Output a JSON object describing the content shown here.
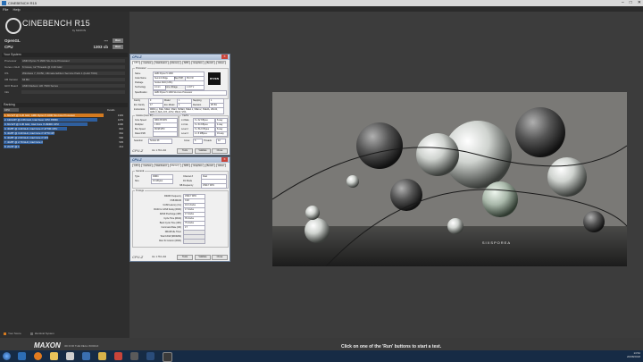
{
  "window": {
    "title": "CINEBENCH R15"
  },
  "menu": [
    "File",
    "Help"
  ],
  "app": {
    "name": "CINEBENCH R15",
    "by": "by MAXON"
  },
  "benchmarks": [
    {
      "label": "OpenGL",
      "value": "---",
      "run": "Run"
    },
    {
      "label": "CPU",
      "value": "1303 cb",
      "run": "Run"
    }
  ],
  "system": {
    "header": "Your System",
    "rows": [
      {
        "k": "Processor",
        "v": "AMD Ryzen 5 1600 Six-Core Processor"
      },
      {
        "k": "Cores x GHz",
        "v": "6 Cores, 12 Threads @ 3.20 GHz"
      },
      {
        "k": "OS",
        "v": "Windows 7, 64 Bit, Ultimate Edition Service Pack 1 (build 7601)"
      },
      {
        "k": "CB Version",
        "v": "64 Bit"
      },
      {
        "k": "GFX Board",
        "v": "AMD Radeon HD 7900 Series"
      },
      {
        "k": "Info",
        "v": ""
      }
    ]
  },
  "ranking": {
    "header": "Ranking",
    "dropdown": "CPU",
    "details": "Details",
    "items": [
      {
        "label": "1. 6C/12T @ 3.20 GHz, AMD Ryzen 5 1600 Six-Core Processor",
        "score": "1303",
        "color": "#d47a1f",
        "frac": 1.0
      },
      {
        "label": "2. 12C/24T @ 2.66 GHz, Intel Xeon CPU X5650",
        "score": "1279",
        "color": "#2f5f9e",
        "frac": 0.94
      },
      {
        "label": "3. 6C/12T @ 3.30 GHz, Intel Core i7-3930K CPU",
        "score": "1096",
        "color": "#2f5f9e",
        "frac": 0.84
      },
      {
        "label": "4. 4C/8T @ 4.40 GHz, Intel Core i7-4770K CPU",
        "score": "822",
        "color": "#2f5f9e",
        "frac": 0.63
      },
      {
        "label": "5. 4C/8T @ 3.40 GHz, Intel Core i7-3770 CPU",
        "score": "662",
        "color": "#2f5f9e",
        "frac": 0.51
      },
      {
        "label": "6. 4C/8T @ 2.60 GHz, Intel Core i7-3720QM CPU",
        "score": "590",
        "color": "#2f5f9e",
        "frac": 0.45
      },
      {
        "label": "7. 4C/8T @ 2.79 GHz, Intel Core i7-3840QM CPU",
        "score": "505",
        "color": "#2f5f9e",
        "frac": 0.39
      },
      {
        "label": "8. 2C/4T @ 1.70 GHz, Intel Core i5-3317U CPU",
        "score": "214",
        "color": "#2f5f9e",
        "frac": 0.16
      }
    ]
  },
  "legend": {
    "your_score": "Your Score",
    "identical": "Identical System",
    "your_color": "#d47a1f",
    "identical_color": "#6a6a6a"
  },
  "footer": {
    "brand": "MAXON",
    "tagline": "3D FOR THE REAL WORLD"
  },
  "status": "Click on one of the 'Run' buttons to start a test.",
  "render_watermark": "SIXSPOREA",
  "cpuz1": {
    "brand": "CPU-Z",
    "tabs": [
      "CPU",
      "Caches",
      "Mainboard",
      "Memory",
      "SPD",
      "Graphics",
      "Bench",
      "About"
    ],
    "processor": {
      "title": "Processor",
      "name_k": "Name",
      "name_v": "AMD Ryzen 5 1600",
      "codename_k": "Code Name",
      "codename_v": "Summit Ridge",
      "maxtdp_k": "Max TDP",
      "maxtdp_v": "65.0 W",
      "package_k": "Package",
      "package_v": "Socket AM4 (1331)",
      "tech_k": "Technology",
      "tech_v": "14 nm",
      "vcore_k": "Core Voltage",
      "vcore_v": "1.017 V"
    },
    "spec_k": "Specification",
    "spec_v": "AMD Ryzen 5 1600 Six-Core Processor",
    "family_k": "Family",
    "family_v": "F",
    "model_k": "Model",
    "model_v": "1",
    "stepping_k": "Stepping",
    "stepping_v": "1",
    "extfam_k": "Ext. Family",
    "extfam_v": "17",
    "extmodel_k": "Ext. Model",
    "extmodel_v": "1",
    "rev_k": "Revision",
    "rev_v": "ZP-B1",
    "instr_k": "Instructions",
    "instr_v": "MMX(+), SSE, SSE2, SSE3, SSSE3, SSE4.1, SSE4.2, SSE4A, x86-64, AMD-V, AES, AVX, AVX2, FMA3, SHA",
    "clocks_title": "Clocks (Core #0)",
    "corespeed_k": "Core Speed",
    "corespeed_v": "3800.35 MHz",
    "mult_k": "Multiplier",
    "mult_v": "x 38.0",
    "bus_k": "Bus Speed",
    "bus_v": "99.98 MHz",
    "fsb_k": "Rated FSB",
    "fsb_v": "",
    "cache_title": "Cache",
    "l1d_k": "L1 Data",
    "l1d_v": "6 x 32 KBytes",
    "l1d_w": "8-way",
    "l1i_k": "L1 Inst.",
    "l1i_v": "6 x 64 KBytes",
    "l1i_w": "4-way",
    "l2_k": "Level 2",
    "l2_v": "6 x 512 KBytes",
    "l2_w": "8-way",
    "l3_k": "Level 3",
    "l3_v": "2 x 8 MBytes",
    "l3_w": "16-way",
    "sel_k": "Selection",
    "sel_v": "Socket #1",
    "cores_k": "Cores",
    "cores_v": "6",
    "threads_k": "Threads",
    "threads_v": "12",
    "ver": "Ver. 1.78.1.x64",
    "tools": "Tools",
    "validate": "Validate",
    "close": "Close",
    "amd_badge": "RYZEN"
  },
  "cpuz2": {
    "brand": "CPU-Z",
    "tabs": [
      "CPU",
      "Caches",
      "Mainboard",
      "Memory",
      "SPD",
      "Graphics",
      "Bench",
      "About"
    ],
    "general_title": "General",
    "type_k": "Type",
    "type_v": "DDR4",
    "channel_k": "Channel #",
    "channel_v": "Dual",
    "size_k": "Size",
    "size_v": "16 GBytes",
    "dcmode_k": "DC Mode",
    "dcmode_v": "",
    "nbfreq_k": "NB Frequency",
    "nbfreq_v": "1599.7 MHz",
    "timings_title": "Timings",
    "timings": [
      {
        "k": "DRAM Frequency",
        "v": "1599.7 MHz"
      },
      {
        "k": "FSB:DRAM",
        "v": "3:48"
      },
      {
        "k": "CAS# Latency (CL)",
        "v": "16.0 clocks"
      },
      {
        "k": "RAS# to CAS# Delay (tRCD)",
        "v": "17 clocks"
      },
      {
        "k": "RAS# Precharge (tRP)",
        "v": "17 clocks"
      },
      {
        "k": "Cycle Time (tRAS)",
        "v": "35 clocks"
      },
      {
        "k": "Bank Cycle Time (tRC)",
        "v": "75 clocks"
      },
      {
        "k": "Command Rate (CR)",
        "v": "1T"
      },
      {
        "k": "DRAM Idle Timer",
        "v": ""
      },
      {
        "k": "Total CAS# (tRDRAM)",
        "v": ""
      },
      {
        "k": "Row To Column (tRCD)",
        "v": ""
      }
    ],
    "ver": "Ver. 1.78.1.x64",
    "tools": "Tools",
    "validate": "Validate",
    "close": "Close"
  },
  "taskbar": {
    "time": "13:52",
    "date": "20/08/2018"
  }
}
